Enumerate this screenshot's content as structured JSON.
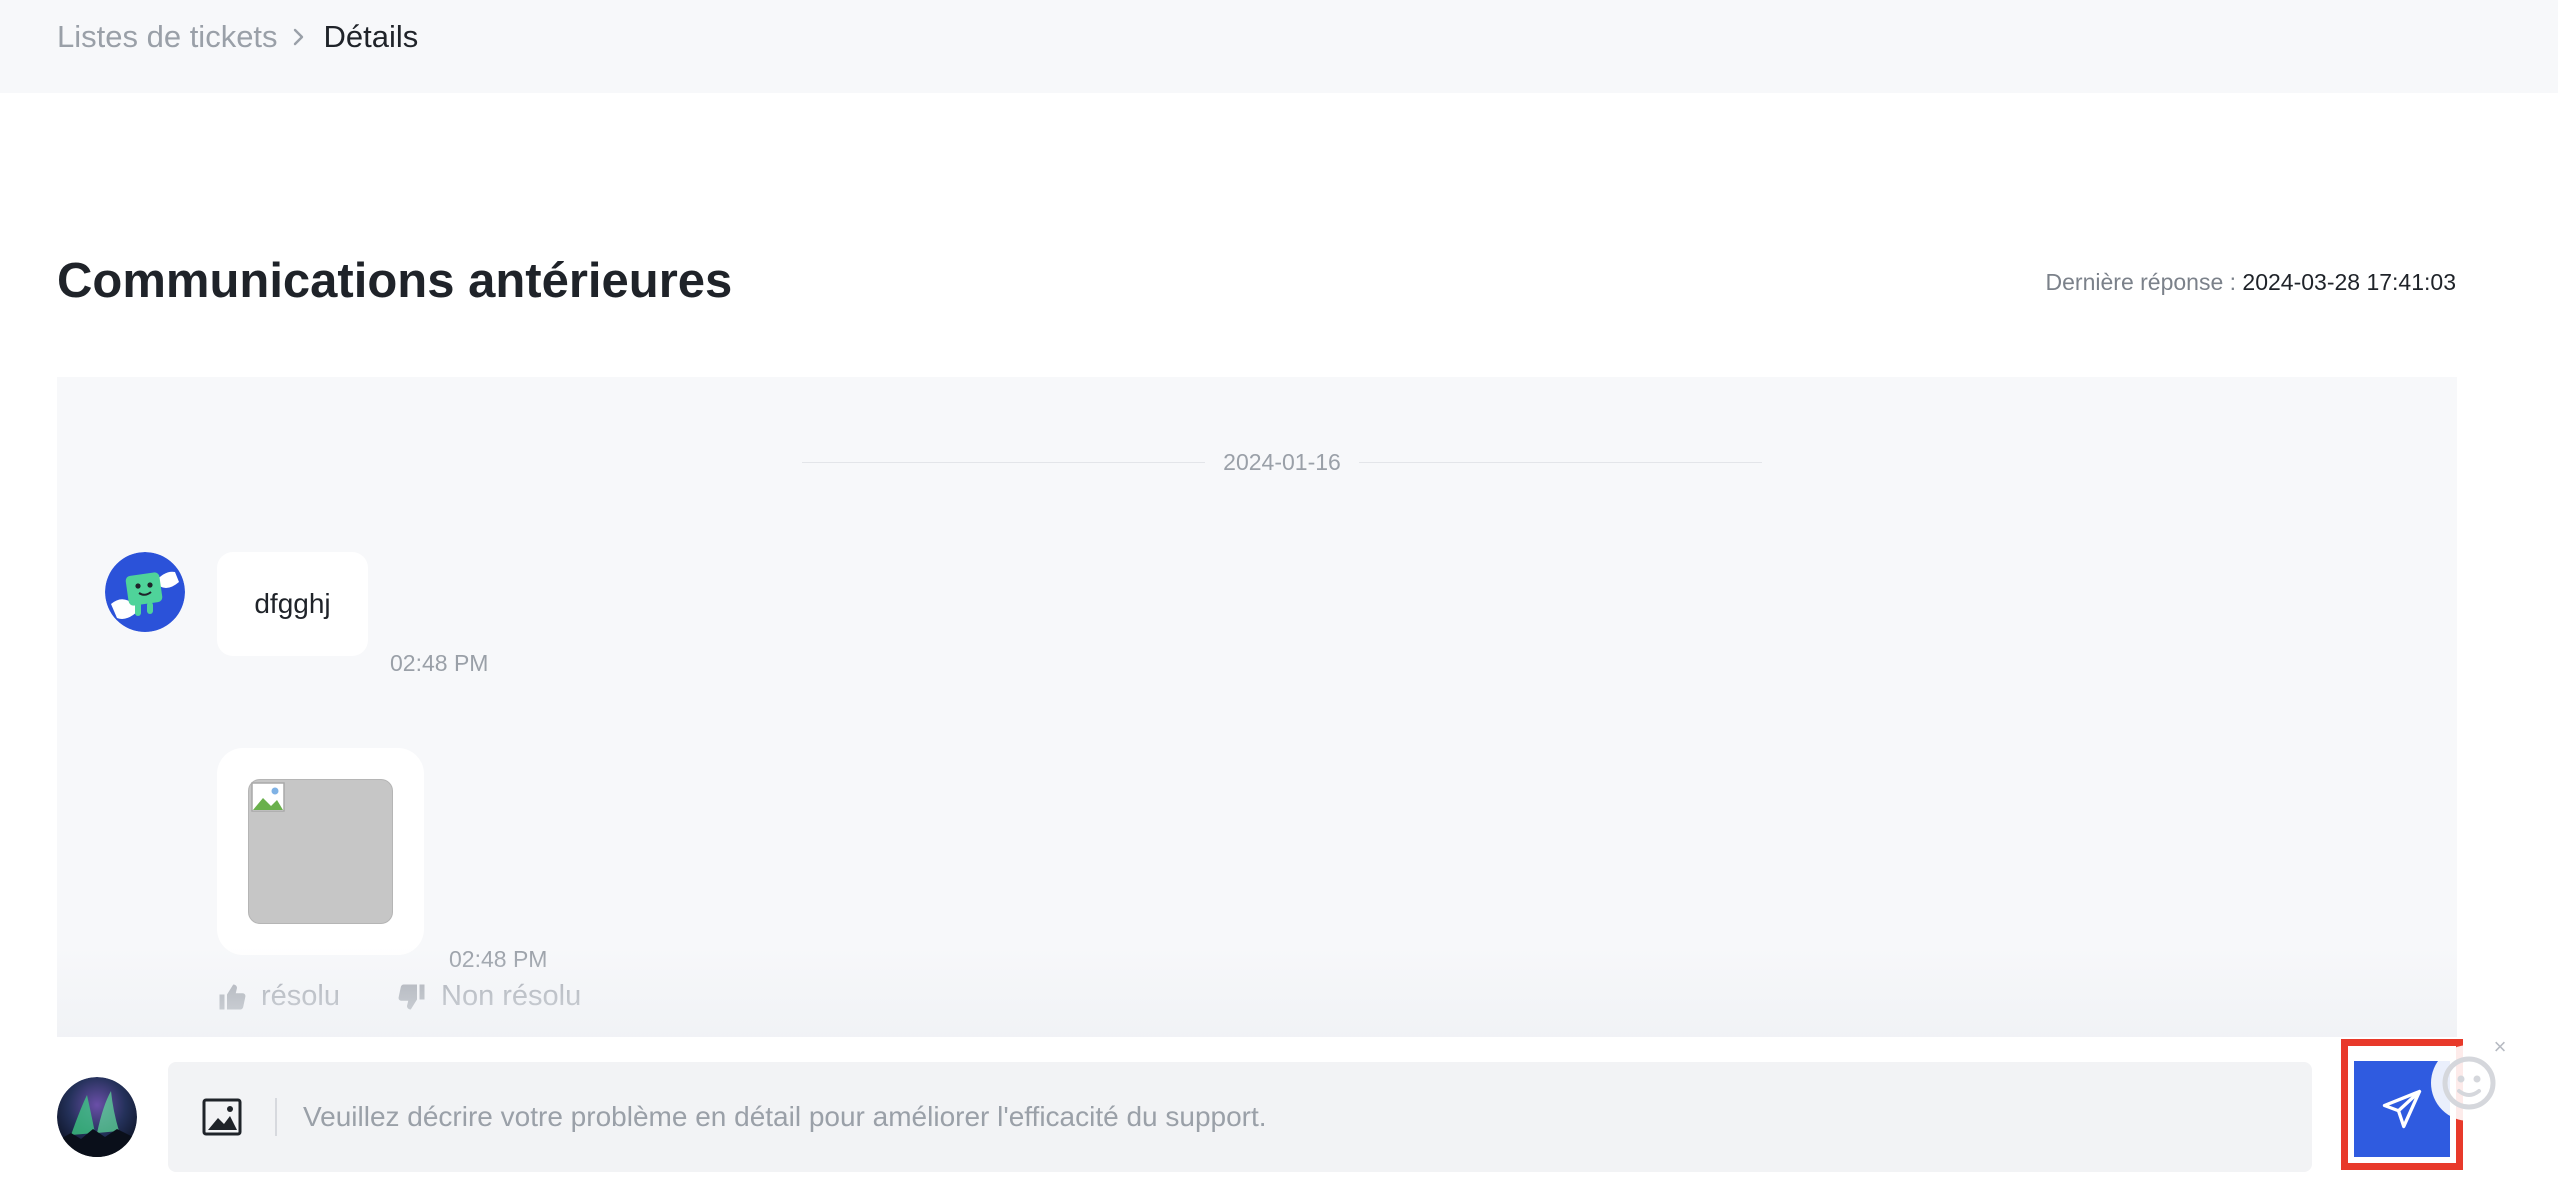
{
  "breadcrumb": {
    "parent": "Listes de tickets",
    "current": "Détails"
  },
  "section": {
    "title": "Communications antérieures",
    "last_reply_label": "Dernière réponse :",
    "last_reply_value": "2024-03-28 17:41:03"
  },
  "chat": {
    "date_separator": "2024-01-16",
    "messages": [
      {
        "type": "text",
        "text": "dfgghj",
        "time": "02:48 PM"
      },
      {
        "type": "image",
        "time": "02:48 PM"
      }
    ],
    "feedback": {
      "resolved_label": "résolu",
      "unresolved_label": "Non résolu"
    }
  },
  "composer": {
    "placeholder": "Veuillez décrire votre problème en détail pour améliorer l'efficacité du support.",
    "value": ""
  },
  "icons": {
    "breadcrumb_separator": "chevron-right-icon",
    "upload": "image-icon",
    "send": "send-icon",
    "like": "thumbs-up-icon",
    "dislike": "thumbs-down-icon",
    "helper": "smiley-bot-icon",
    "close": "close-icon"
  },
  "colors": {
    "accent": "#2f5be0",
    "highlight_border": "#e8392a",
    "chat_background": "#f7f8fa"
  }
}
